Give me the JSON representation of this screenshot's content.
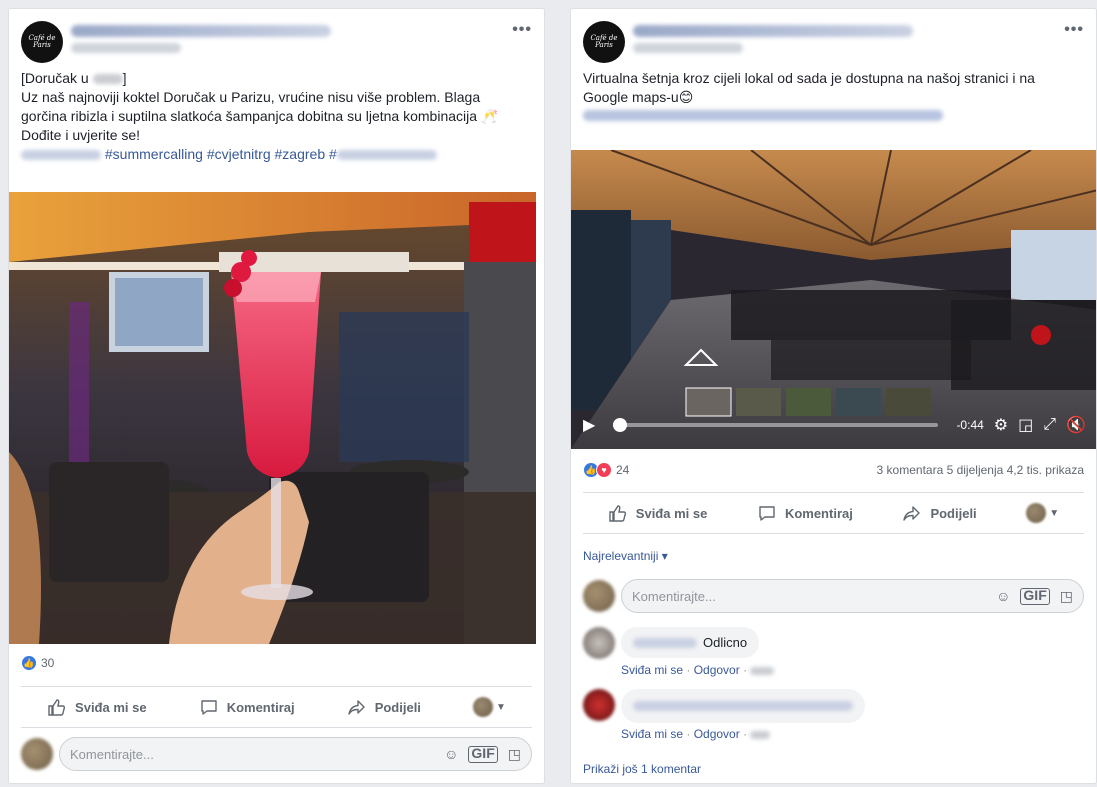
{
  "left_post": {
    "page_logo": "Café de Paris",
    "more": "•••",
    "text_line1_prefix": "[Doručak u ",
    "text_line1_suffix": "]",
    "text_line2": "Uz naš najnoviji koktel Doručak u Parizu, vrućine nisu više problem. Blaga",
    "text_line3": "gorčina ribizla i suptilna slatkoća šampanjca dobitna su ljetna kombinacija 🥂",
    "text_line4": "Dođite i uvjerite se!",
    "hashtags_mid": " #summercalling #cvjetnitrg #zagreb #",
    "reaction_count": "30",
    "actions": {
      "like": "Sviđa mi se",
      "comment": "Komentiraj",
      "share": "Podijeli"
    },
    "comment_placeholder": "Komentirajte..."
  },
  "right_post": {
    "page_logo": "Café de Paris",
    "more": "•••",
    "text_line1": "Virtualna šetnja kroz cijeli lokal od sada je dostupna na našoj stranici i na",
    "text_line2": "Google maps-u😊",
    "video_time": "-0:44",
    "reaction_count": "24",
    "stats": "3 komentara  5 dijeljenja  4,2 tis. prikaza",
    "actions": {
      "like": "Sviđa mi se",
      "comment": "Komentiraj",
      "share": "Podijeli"
    },
    "sort_label": "Najrelevantniji ▾",
    "comment_placeholder": "Komentirajte...",
    "comments": [
      {
        "text": "Odlicno",
        "like": "Sviđa mi se",
        "reply": "Odgovor"
      },
      {
        "text": "",
        "like": "Sviđa mi se",
        "reply": "Odgovor"
      }
    ],
    "more_comments": "Prikaži još 1 komentar"
  },
  "icons": [
    "like-icon",
    "comment-icon",
    "share-icon",
    "emoji-icon",
    "gif-icon",
    "sticker-icon",
    "play-icon",
    "settings-icon",
    "fullscreen-icon",
    "mute-icon"
  ],
  "colors": {
    "accent": "#385898",
    "like_blue": "#3578e5",
    "love_red": "#f33e58"
  },
  "video_progress_fraction": 0.02
}
